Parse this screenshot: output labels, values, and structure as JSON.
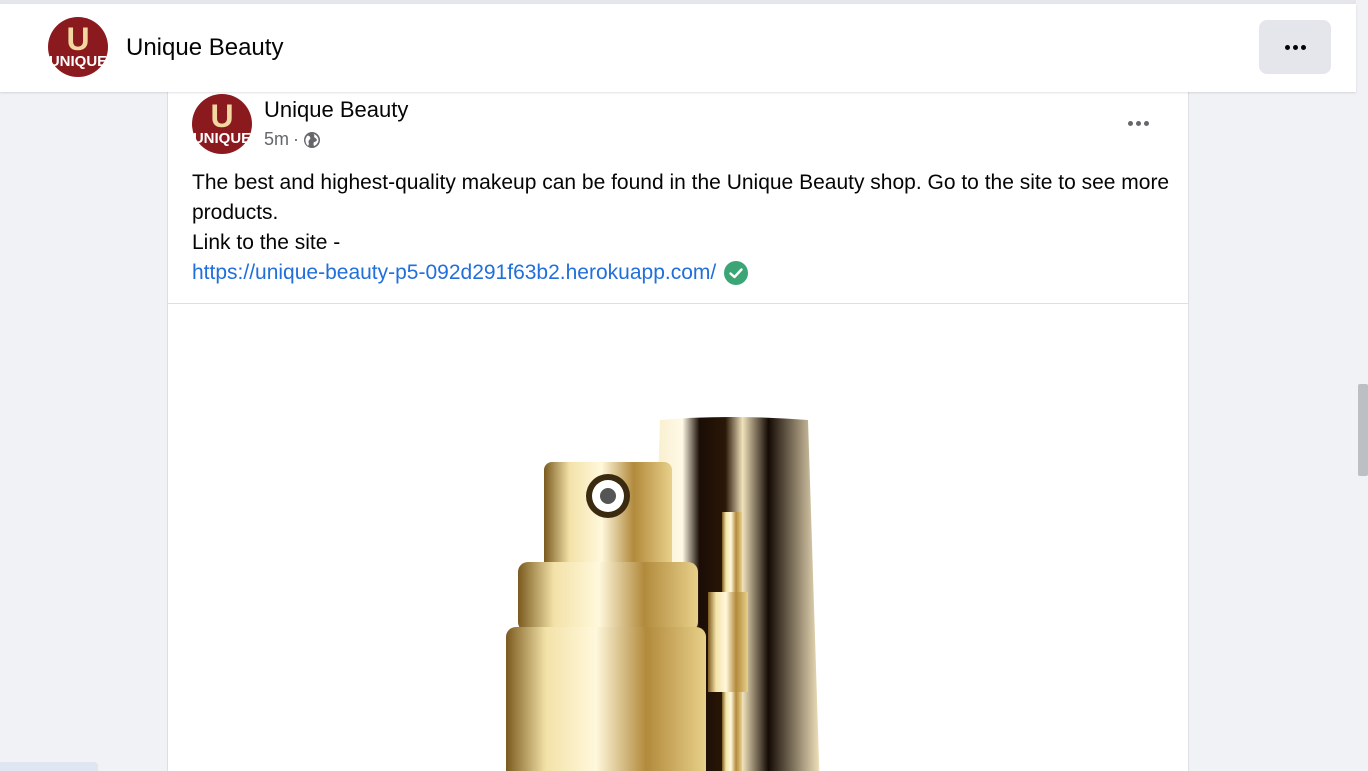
{
  "header": {
    "title": "Unique Beauty",
    "avatar_letter": "U",
    "avatar_word": "UNIQUE",
    "more_icon": "more-horizontal-icon"
  },
  "post": {
    "author": "Unique Beauty",
    "time": "5m",
    "separator": "·",
    "privacy_icon": "globe-icon",
    "more_icon": "more-horizontal-icon",
    "text_line1": "The best and highest-quality makeup can be found in the Unique Beauty shop. Go to the site to see more products.",
    "text_line2": "Link to the site -",
    "link": "https://unique-beauty-p5-092d291f63b2.herokuapp.com/",
    "link_check_icon": "verified-check-icon",
    "image_subject": "gold-perfume-bottle"
  },
  "colors": {
    "brand": "#8b1a1f",
    "brand_letter": "#f2d8a0",
    "link": "#216fdb",
    "check": "#3ca576",
    "secondary_text": "#65676b"
  }
}
